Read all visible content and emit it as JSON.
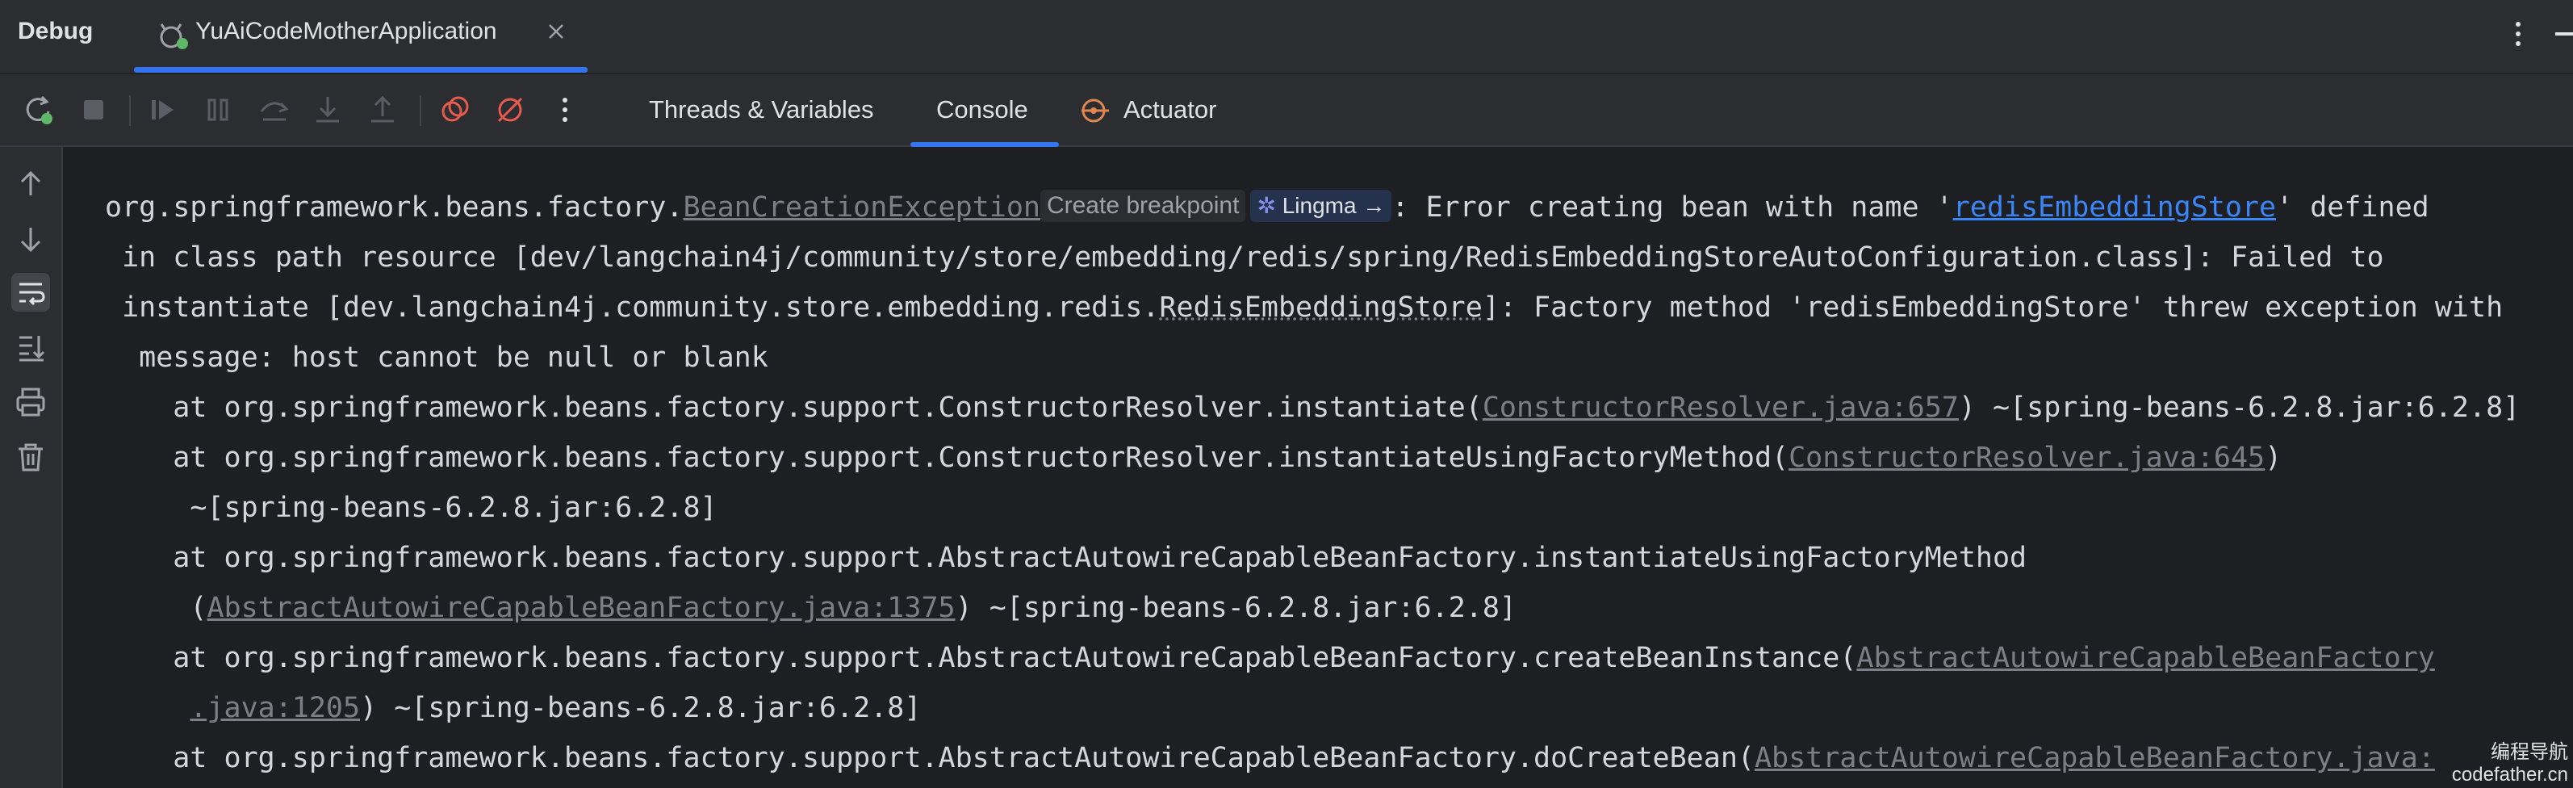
{
  "titlebar": {
    "title": "Debug",
    "tab_label": "YuAiCodeMotherApplication"
  },
  "toolbar": {
    "tabs": [
      {
        "label": "Threads & Variables"
      },
      {
        "label": "Console"
      },
      {
        "label": "Actuator"
      }
    ]
  },
  "console": {
    "line1": {
      "prefix": "org.springframework.beans.factory.",
      "exception_link": "BeanCreationException",
      "inlay_breakpoint": "Create breakpoint",
      "inlay_lingma": "Lingma →",
      "mid": ": Error creating bean with name '",
      "bean_link": "redisEmbeddingStore",
      "suffix": "' defined"
    },
    "line2": " in class path resource [dev/langchain4j/community/store/embedding/redis/spring/RedisEmbeddingStoreAutoConfiguration.class]: Failed to",
    "line3": {
      "prefix": " instantiate [dev.langchain4j.community.store.embedding.redis.",
      "class_ref": "RedisEmbeddingStore",
      "suffix": "]: Factory method 'redisEmbeddingStore' threw exception with"
    },
    "line4": "  message: host cannot be null or blank",
    "line5": {
      "prefix": "    at org.springframework.beans.factory.support.ConstructorResolver.instantiate(",
      "link": "ConstructorResolver.java:657",
      "suffix": ") ~[spring-beans-6.2.8.jar:6.2.8]"
    },
    "line6": {
      "prefix": "    at org.springframework.beans.factory.support.ConstructorResolver.instantiateUsingFactoryMethod(",
      "link": "ConstructorResolver.java:645",
      "suffix": ")"
    },
    "line7": "     ~[spring-beans-6.2.8.jar:6.2.8]",
    "line8": "    at org.springframework.beans.factory.support.AbstractAutowireCapableBeanFactory.instantiateUsingFactoryMethod",
    "line9": {
      "prefix": "     (",
      "link": "AbstractAutowireCapableBeanFactory.java:1375",
      "suffix": ") ~[spring-beans-6.2.8.jar:6.2.8]"
    },
    "line10": {
      "prefix": "    at org.springframework.beans.factory.support.AbstractAutowireCapableBeanFactory.createBeanInstance(",
      "link": "AbstractAutowireCapableBeanFactory"
    },
    "line11": {
      "prefix": "     ",
      "link": ".java:1205",
      "suffix": ") ~[spring-beans-6.2.8.jar:6.2.8]"
    },
    "line12": {
      "prefix": "    at org.springframework.beans.factory.support.AbstractAutowireCapableBeanFactory.doCreateBean(",
      "link": "AbstractAutowireCapableBeanFactory.java:"
    }
  },
  "watermark": {
    "line1": "编程导航",
    "line2": "codefather.cn"
  },
  "colors": {
    "accent": "#3574f0",
    "link": "#3b86f7",
    "rerun_green": "#5fb865",
    "breakpoint_red": "#e55b4d",
    "actuator_orange": "#e0864f"
  }
}
